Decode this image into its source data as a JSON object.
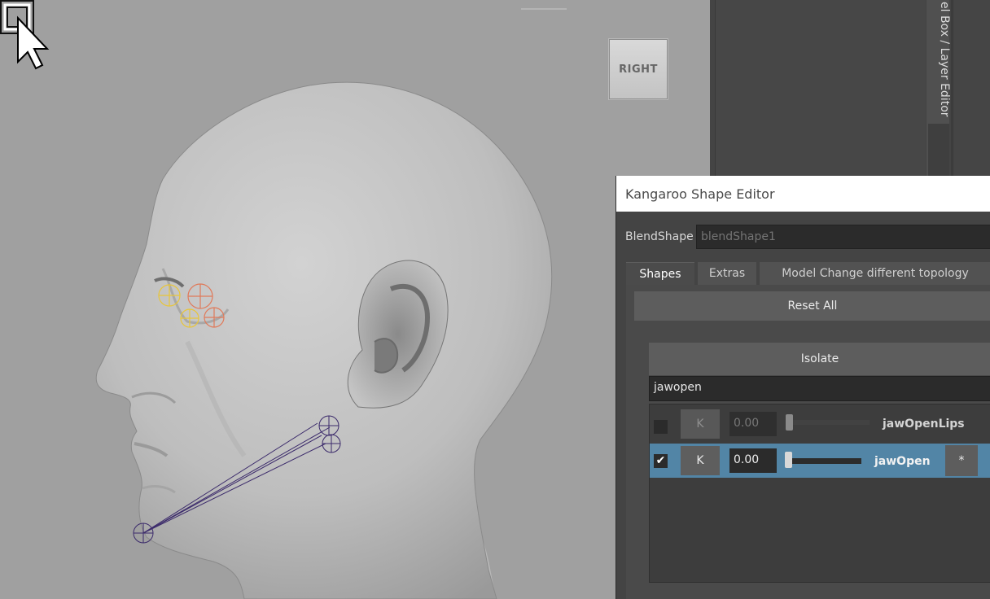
{
  "viewport": {
    "view_cube_label": "RIGHT"
  },
  "side_dock": {
    "tab_label": "el Box / Layer Editor"
  },
  "editor": {
    "title": "Kangaroo Shape Editor",
    "blendshape_label": "BlendShape",
    "blendshape_value": "blendShape1",
    "tabs": [
      {
        "label": "Shapes",
        "active": true
      },
      {
        "label": "Extras",
        "active": false
      },
      {
        "label": "Model Change different topology",
        "active": false
      }
    ],
    "reset_all_label": "Reset All",
    "isolate_label": "Isolate",
    "filter_value": "jawopen",
    "rows": [
      {
        "checked": false,
        "check_mark": "",
        "key_label": "K",
        "value": "0.00",
        "slider_fraction": 0.0,
        "name": "jawOpenLips",
        "selected": false
      },
      {
        "checked": true,
        "check_mark": "✔",
        "key_label": "K",
        "value": "0.00",
        "slider_fraction": 0.0,
        "name": "jawOpen",
        "selected": true,
        "extra_label": "*"
      }
    ]
  },
  "colors": {
    "viewport_bg": "#a0a0a0",
    "selection_row": "#5285a6",
    "panel_bg": "#444444"
  }
}
